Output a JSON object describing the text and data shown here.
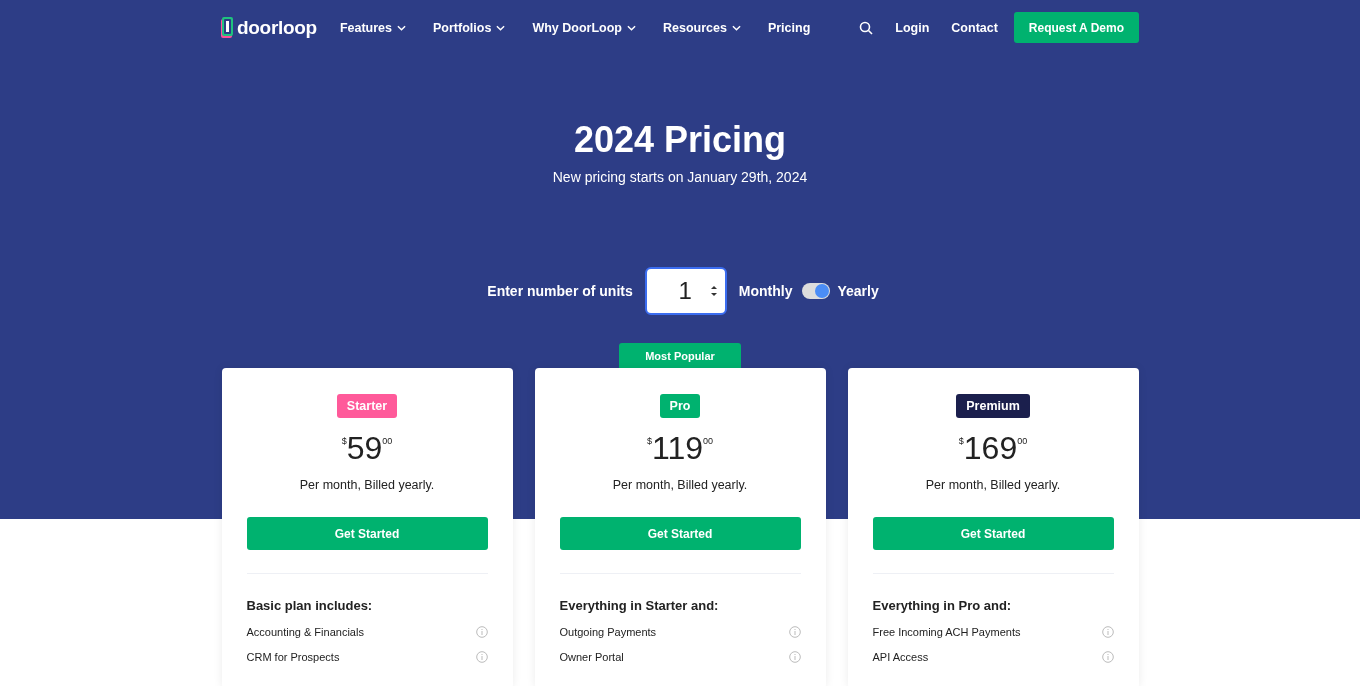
{
  "nav": {
    "logo": "doorloop",
    "items": [
      {
        "label": "Features",
        "dropdown": true
      },
      {
        "label": "Portfolios",
        "dropdown": true
      },
      {
        "label": "Why DoorLoop",
        "dropdown": true
      },
      {
        "label": "Resources",
        "dropdown": true
      },
      {
        "label": "Pricing",
        "dropdown": false
      }
    ],
    "links": [
      "Login",
      "Contact"
    ],
    "cta": "Request A Demo"
  },
  "hero": {
    "title": "2024 Pricing",
    "subtitle": "New pricing starts on January 29th, 2024"
  },
  "units": {
    "label": "Enter number of units",
    "value": "1"
  },
  "billing": {
    "monthly_label": "Monthly",
    "yearly_label": "Yearly",
    "yearly": true
  },
  "plans": [
    {
      "badge": "Starter",
      "color": "#ff5a9a",
      "currency": "$",
      "price": "59",
      "cents": "00",
      "period": "Per month, Billed yearly.",
      "button": "Get Started",
      "heading": "Basic plan includes:",
      "features": [
        "Accounting & Financials",
        "CRM for Prospects"
      ]
    },
    {
      "badge": "Pro",
      "color": "#00b26f",
      "ribbon": "Most Popular",
      "currency": "$",
      "price": "119",
      "cents": "00",
      "period": "Per month, Billed yearly.",
      "button": "Get Started",
      "heading": "Everything in Starter and:",
      "features": [
        "Outgoing Payments",
        "Owner Portal"
      ]
    },
    {
      "badge": "Premium",
      "color": "#1b1f4d",
      "currency": "$",
      "price": "169",
      "cents": "00",
      "period": "Per month, Billed yearly.",
      "button": "Get Started",
      "heading": "Everything in Pro and:",
      "features": [
        "Free Incoming ACH Payments",
        "API Access"
      ]
    }
  ]
}
